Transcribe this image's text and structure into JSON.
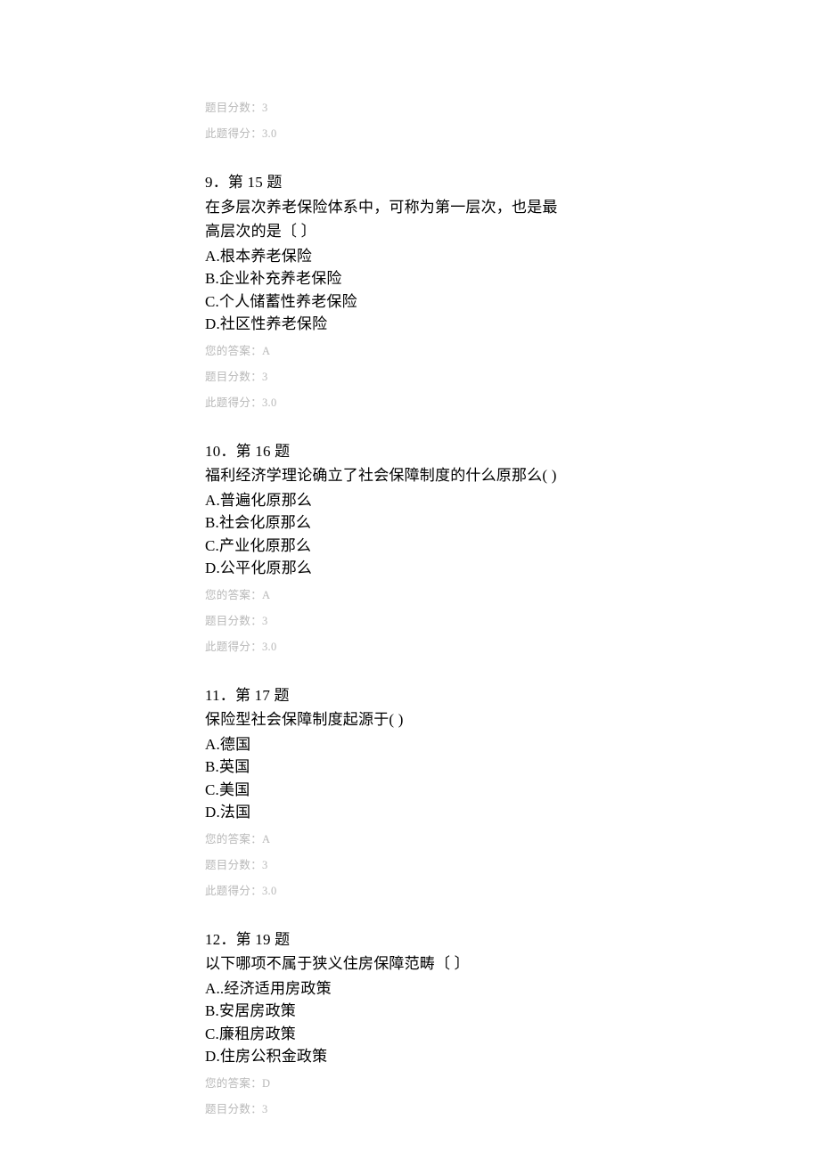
{
  "prequestion_meta": {
    "points_label": "题目分数：3",
    "score_label": "此题得分：3.0"
  },
  "questions": [
    {
      "header": "9．第 15 题",
      "text_lines": [
        "在多层次养老保险体系中，可称为第一层次，也是最",
        "高层次的是〔 〕"
      ],
      "options": [
        "A.根本养老保险",
        "B.企业补充养老保险",
        "C.个人储蓄性养老保险",
        "D.社区性养老保险"
      ],
      "answer_label": "您的答案：A",
      "points_label": "题目分数：3",
      "score_label": "此题得分：3.0"
    },
    {
      "header": "10．第 16 题",
      "text_lines": [
        "福利经济学理论确立了社会保障制度的什么原那么( )"
      ],
      "options": [
        "A.普遍化原那么",
        "B.社会化原那么",
        "C.产业化原那么",
        "D.公平化原那么"
      ],
      "answer_label": "您的答案：A",
      "points_label": "题目分数：3",
      "score_label": "此题得分：3.0"
    },
    {
      "header": "11．第 17 题",
      "text_lines": [
        "保险型社会保障制度起源于( )"
      ],
      "options": [
        "A.德国",
        "B.英国",
        "C.美国",
        "D.法国"
      ],
      "answer_label": "您的答案：A",
      "points_label": "题目分数：3",
      "score_label": "此题得分：3.0"
    },
    {
      "header": "12．第 19 题",
      "text_lines": [
        "以下哪项不属于狭义住房保障范畴〔 〕"
      ],
      "options": [
        "A..经济适用房政策",
        "B.安居房政策",
        "C.廉租房政策",
        "D.住房公积金政策"
      ],
      "answer_label": "您的答案：D",
      "points_label": "题目分数：3",
      "score_label": ""
    }
  ]
}
